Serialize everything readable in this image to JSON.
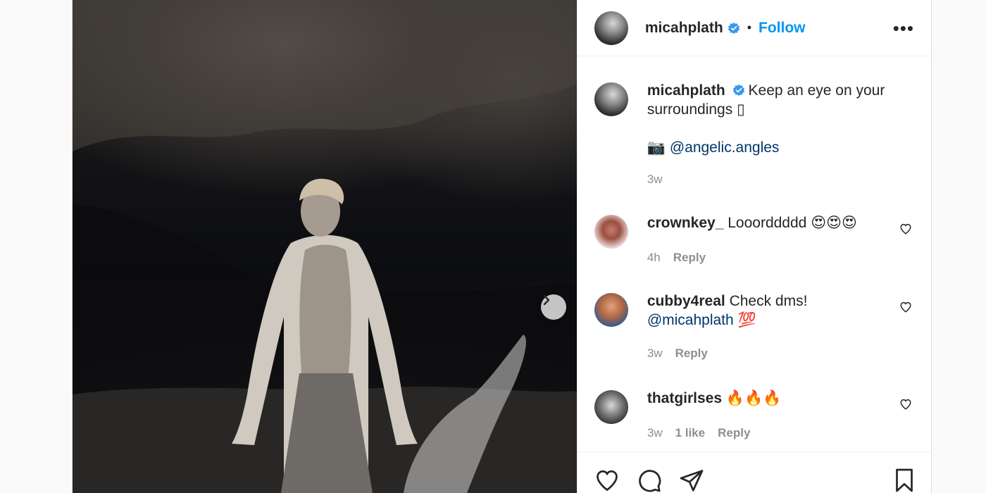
{
  "post": {
    "owner": "micahplath",
    "follow_label": "Follow",
    "dot": "•",
    "more": "•••"
  },
  "caption": {
    "username": "micahplath",
    "line1": "Keep an eye on your",
    "line2": "surroundings ",
    "line2_glyph": "▯",
    "camera_emoji": "📷",
    "mention": "@angelic.angles",
    "time": "3w"
  },
  "comments": [
    {
      "username": "crownkey_",
      "text": "Looorddddd ",
      "emoji": "😍😍😍",
      "time": "4h",
      "reply": "Reply"
    },
    {
      "username": "cubby4real",
      "text": "Check dms!",
      "mention": "@micahplath",
      "emoji": "💯",
      "time": "3w",
      "reply": "Reply"
    },
    {
      "username": "thatgirlses",
      "text": "",
      "emoji": "🔥🔥🔥",
      "time": "3w",
      "likes": "1 like",
      "reply": "Reply"
    }
  ],
  "colors": {
    "accent": "#0095f6",
    "verified": "#3897f0",
    "mention": "#00376b",
    "muted": "#8e8e8e"
  },
  "icons": [
    "verified-badge-icon",
    "more-options-icon",
    "chevron-right-icon",
    "heart-icon",
    "comment-icon",
    "share-icon",
    "bookmark-icon"
  ]
}
